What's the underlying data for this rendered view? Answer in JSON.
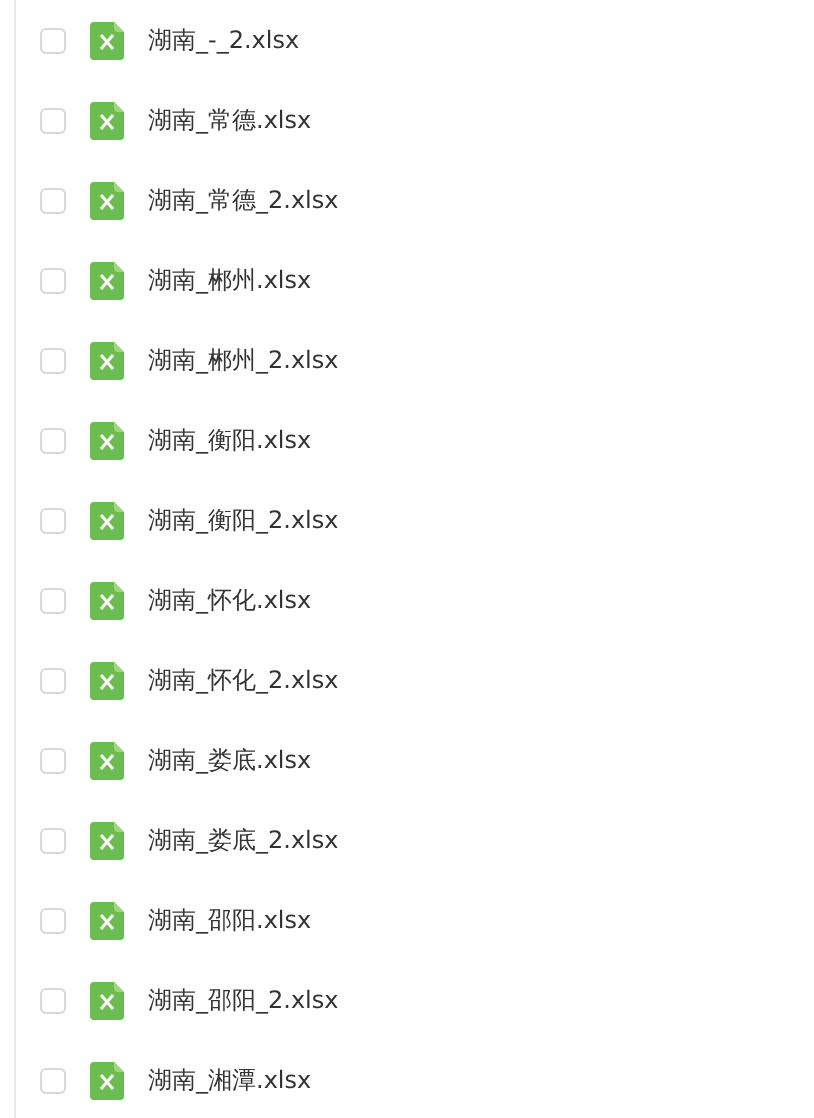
{
  "files": [
    {
      "name": "湖南_-_2.xlsx",
      "checked": false
    },
    {
      "name": "湖南_常德.xlsx",
      "checked": false
    },
    {
      "name": "湖南_常德_2.xlsx",
      "checked": false
    },
    {
      "name": "湖南_郴州.xlsx",
      "checked": false
    },
    {
      "name": "湖南_郴州_2.xlsx",
      "checked": false
    },
    {
      "name": "湖南_衡阳.xlsx",
      "checked": false
    },
    {
      "name": "湖南_衡阳_2.xlsx",
      "checked": false
    },
    {
      "name": "湖南_怀化.xlsx",
      "checked": false
    },
    {
      "name": "湖南_怀化_2.xlsx",
      "checked": false
    },
    {
      "name": "湖南_娄底.xlsx",
      "checked": false
    },
    {
      "name": "湖南_娄底_2.xlsx",
      "checked": false
    },
    {
      "name": "湖南_邵阳.xlsx",
      "checked": false
    },
    {
      "name": "湖南_邵阳_2.xlsx",
      "checked": false
    },
    {
      "name": "湖南_湘潭.xlsx",
      "checked": false
    }
  ]
}
